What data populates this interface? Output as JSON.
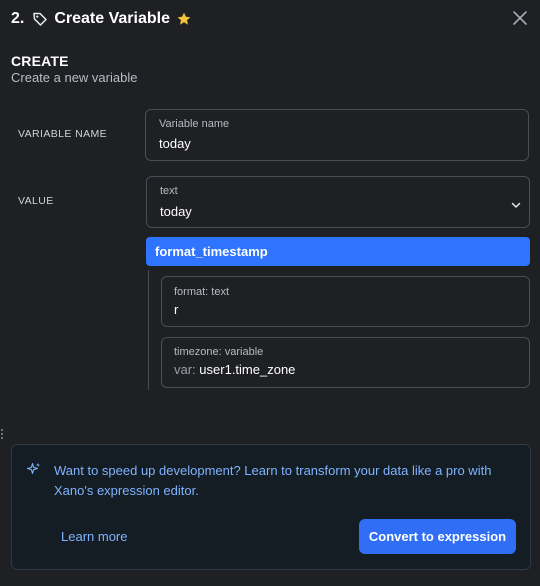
{
  "header": {
    "step": "2.",
    "title": "Create Variable",
    "icons": {
      "tag": "tag-icon",
      "star": "star-icon",
      "close": "close-icon"
    },
    "star_color": "#f4c33a"
  },
  "section": {
    "title": "CREATE",
    "subtitle": "Create a new variable"
  },
  "variable_name": {
    "row_label": "VARIABLE NAME",
    "field_label": "Variable name",
    "value": "today"
  },
  "value": {
    "row_label": "VALUE",
    "type_label": "text",
    "value": "today",
    "filter": {
      "name": "format_timestamp",
      "args": [
        {
          "label": "format: text",
          "prefix": "",
          "value": "r"
        },
        {
          "label": "timezone: variable",
          "prefix": "var:",
          "value": "user1.time_zone"
        }
      ]
    }
  },
  "promo": {
    "icon": "sparkle-icon",
    "text": "Want to speed up development? Learn to transform your data like a pro with Xano's expression editor.",
    "learn_more": "Learn more",
    "convert_button": "Convert to expression"
  },
  "colors": {
    "background": "#1f2024",
    "accent": "#2f74ff",
    "link": "#7fb3ff",
    "promo_bg": "#141d24"
  }
}
